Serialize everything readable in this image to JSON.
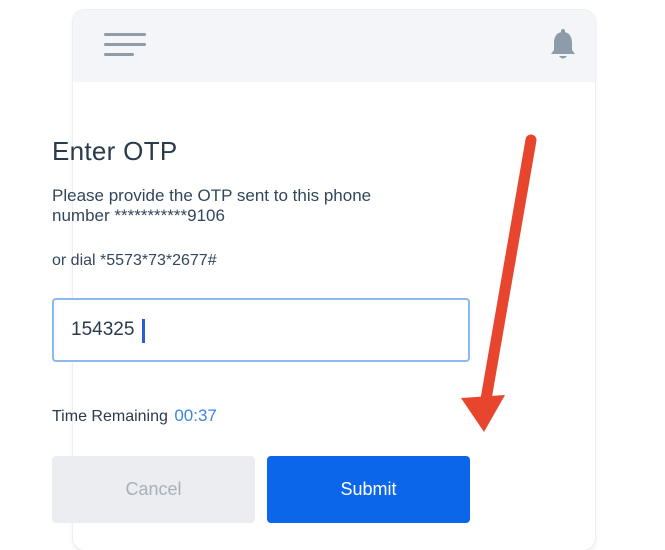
{
  "header": {
    "menu_icon": "menu-icon",
    "notification_icon": "bell-icon"
  },
  "otp_form": {
    "title": "Enter OTP",
    "description": "Please provide the OTP sent to this phone number ***********9106",
    "dial_text": "or dial *5573*73*2677#",
    "otp_value": "154325",
    "otp_placeholder": "",
    "time_label": "Time Remaining",
    "time_value": "00:37",
    "cancel_label": "Cancel",
    "submit_label": "Submit"
  },
  "colors": {
    "accent": "#0b66ea",
    "timer": "#3a86e0",
    "input_border": "#8db9ef",
    "annotation_arrow": "#e8452f"
  }
}
